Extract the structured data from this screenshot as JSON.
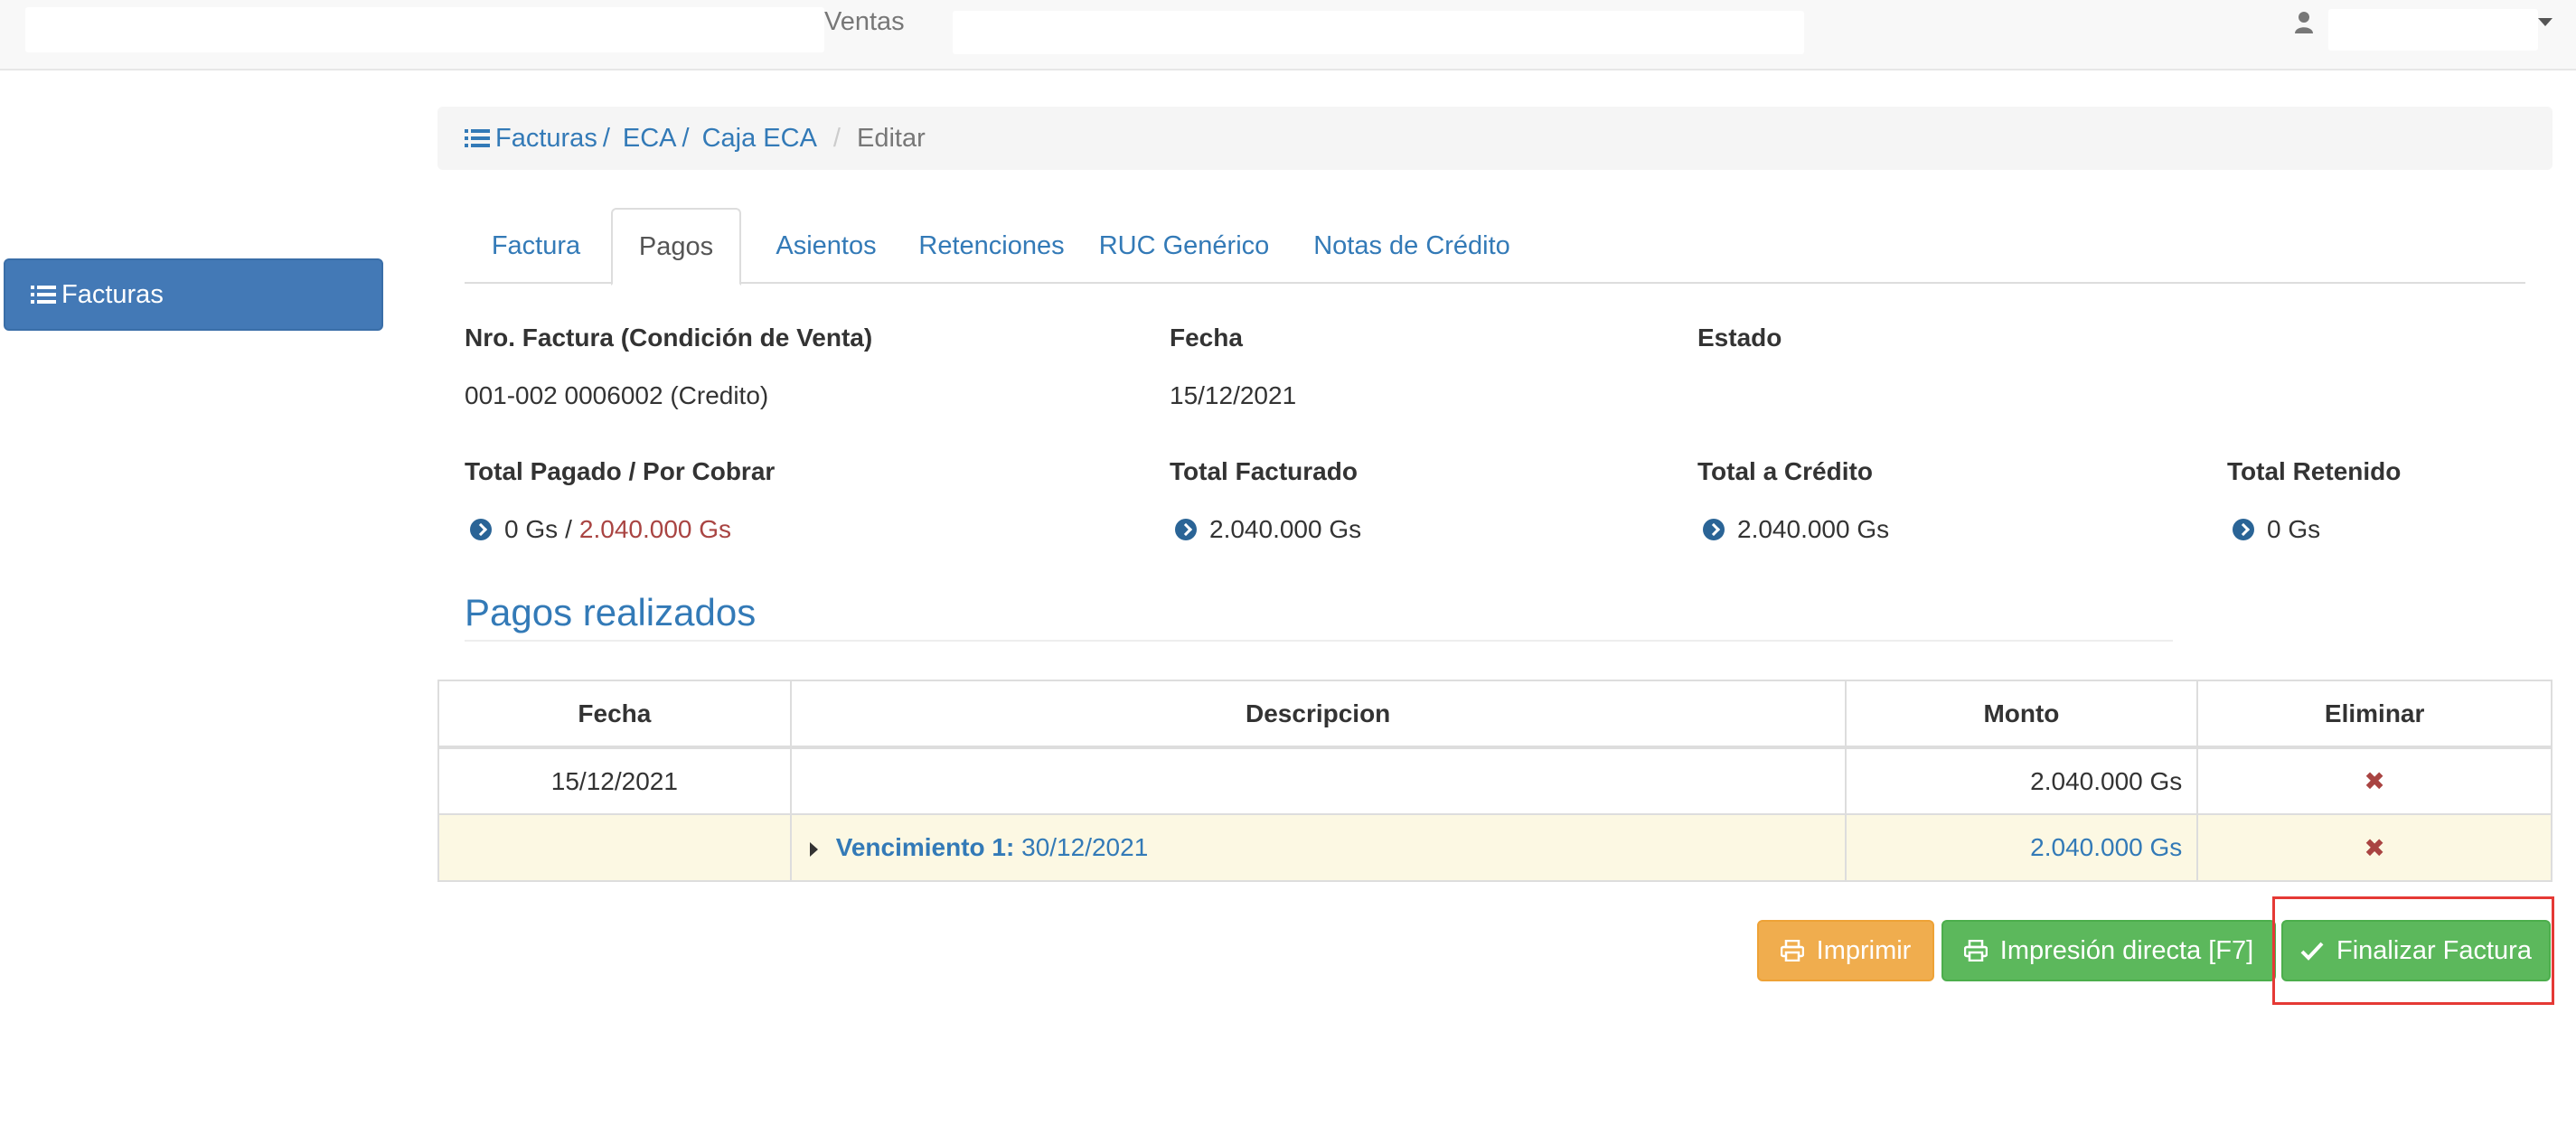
{
  "navbar": {
    "section_label": "Ventas"
  },
  "sidebar": {
    "items": [
      {
        "label": "Facturas",
        "icon": "list-icon"
      }
    ]
  },
  "breadcrumb": {
    "items": [
      "Facturas",
      "ECA",
      "Caja ECA"
    ],
    "active": "Editar"
  },
  "tabs": [
    {
      "label": "Factura",
      "active": false
    },
    {
      "label": "Pagos",
      "active": true
    },
    {
      "label": "Asientos",
      "active": false
    },
    {
      "label": "Retenciones",
      "active": false
    },
    {
      "label": "RUC Genérico",
      "active": false
    },
    {
      "label": "Notas de Crédito",
      "active": false
    }
  ],
  "invoice": {
    "nro_label": "Nro. Factura (Condición de Venta)",
    "nro_value": "001-002 0006002 (Credito)",
    "fecha_label": "Fecha",
    "fecha_value": "15/12/2021",
    "estado_label": "Estado",
    "estado_value": "",
    "total_pagado_label": "Total Pagado / Por Cobrar",
    "total_pagado_value": "0 Gs",
    "separator": "/",
    "por_cobrar_value": "2.040.000 Gs",
    "total_facturado_label": "Total Facturado",
    "total_facturado_value": "2.040.000 Gs",
    "total_credito_label": "Total a Crédito",
    "total_credito_value": "2.040.000 Gs",
    "total_retenido_label": "Total Retenido",
    "total_retenido_value": "0 Gs"
  },
  "payments": {
    "title": "Pagos realizados",
    "columns": [
      "Fecha",
      "Descripcion",
      "Monto",
      "Eliminar"
    ],
    "rows": [
      {
        "fecha": "15/12/2021",
        "descripcion": "",
        "monto": "2.040.000 Gs"
      }
    ],
    "sub_row": {
      "label": "Vencimiento 1:",
      "date": "30/12/2021",
      "monto": "2.040.000 Gs"
    }
  },
  "actions": {
    "print": "Imprimir",
    "direct_print": "Impresión directa [F7]",
    "finalize": "Finalizar Factura"
  },
  "colors": {
    "primary": "#337ab7",
    "sidebar_active": "#4379b6",
    "warning": "#f0ad4e",
    "success": "#5cb85c",
    "danger": "#a94442",
    "highlight": "#e53935"
  }
}
